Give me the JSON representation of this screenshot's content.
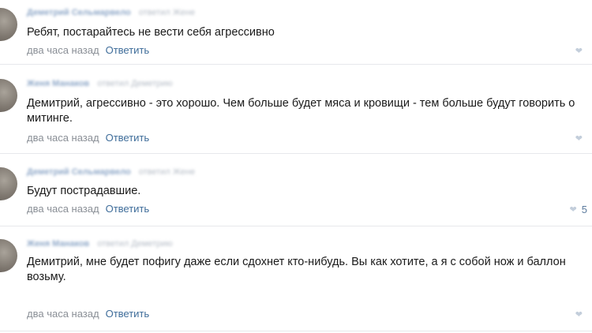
{
  "comments": [
    {
      "author": "Деметрий Сельмарвело",
      "reply_to": "ответил Жене",
      "text": "Ребят, постарайтесь не вести себя агрессивно",
      "time": "два часа назад",
      "reply_label": "Ответить",
      "likes": ""
    },
    {
      "author": "Женя Манаков",
      "reply_to": "ответил Деметрию",
      "text": "Демитрий, агрессивно - это хорошо. Чем больше будет мяса и кровищи - тем больше будут говорить о митинге.",
      "time": "два часа назад",
      "reply_label": "Ответить",
      "likes": ""
    },
    {
      "author": "Деметрий Сельмарвело",
      "reply_to": "ответил Жене",
      "text": "Будут пострадавшие.",
      "time": "два часа назад",
      "reply_label": "Ответить",
      "likes": "5"
    },
    {
      "author": "Женя Манаков",
      "reply_to": "ответил Деметрию",
      "text": "Демитрий, мне будет пофигу даже если сдохнет кто-нибудь. Вы как хотите, а я с собой нож и баллон возьму.",
      "time": "два часа назад",
      "reply_label": "Ответить",
      "likes": ""
    }
  ],
  "icons": {
    "like": "heart-icon"
  },
  "colors": {
    "link": "#3f6d9a",
    "meta": "#8a8f96",
    "author": "#8fa8c8",
    "divider": "#e7e8ec"
  }
}
